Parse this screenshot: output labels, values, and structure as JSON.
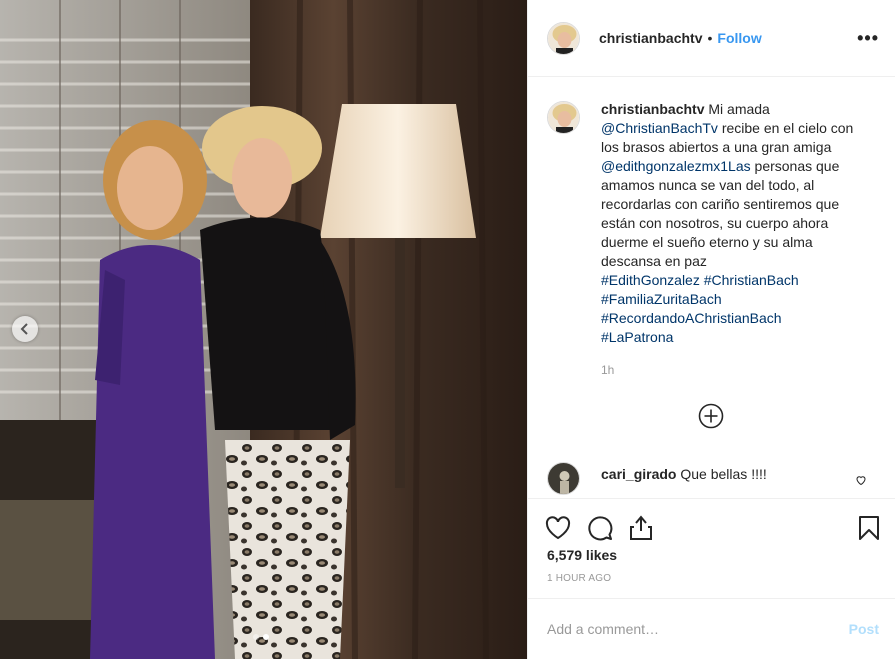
{
  "post": {
    "username": "christianbachtv",
    "separator": "•",
    "follow_label": "Follow",
    "more_icon": "more-options-icon",
    "more_label": "•••"
  },
  "caption": {
    "username": "christianbachtv",
    "text_1": "Mi amada",
    "mention_1": "@ChristianBachTv",
    "text_2": "recibe en el cielo con los brasos abiertos a una gran amiga",
    "mention_2": "@edithgonzalezmx1Las",
    "text_3": "personas que amamos nunca se van del todo, al recordarlas con cariño sentiremos que están con nosotros, su cuerpo ahora duerme el sueño eterno y su alma descansa en paz",
    "hashtags": [
      "#EdithGonzalez",
      "#ChristianBach",
      "#FamiliaZuritaBach",
      "#RecordandoAChristianBach",
      "#LaPatrona"
    ],
    "time": "1h"
  },
  "load_more_icon": "plus-circle-icon",
  "comments": [
    {
      "username": "cari_girado",
      "text": "Que bellas !!!!"
    }
  ],
  "actions": {
    "likes": "6,579 likes",
    "posted": "1 HOUR AGO"
  },
  "add_comment": {
    "placeholder": "Add a comment…",
    "post_label": "Post"
  },
  "carousel": {
    "total": 2,
    "active": 2
  },
  "colors": {
    "link": "#003569",
    "follow": "#3897f0",
    "post_disabled": "#b2dffc",
    "muted": "#999999"
  }
}
